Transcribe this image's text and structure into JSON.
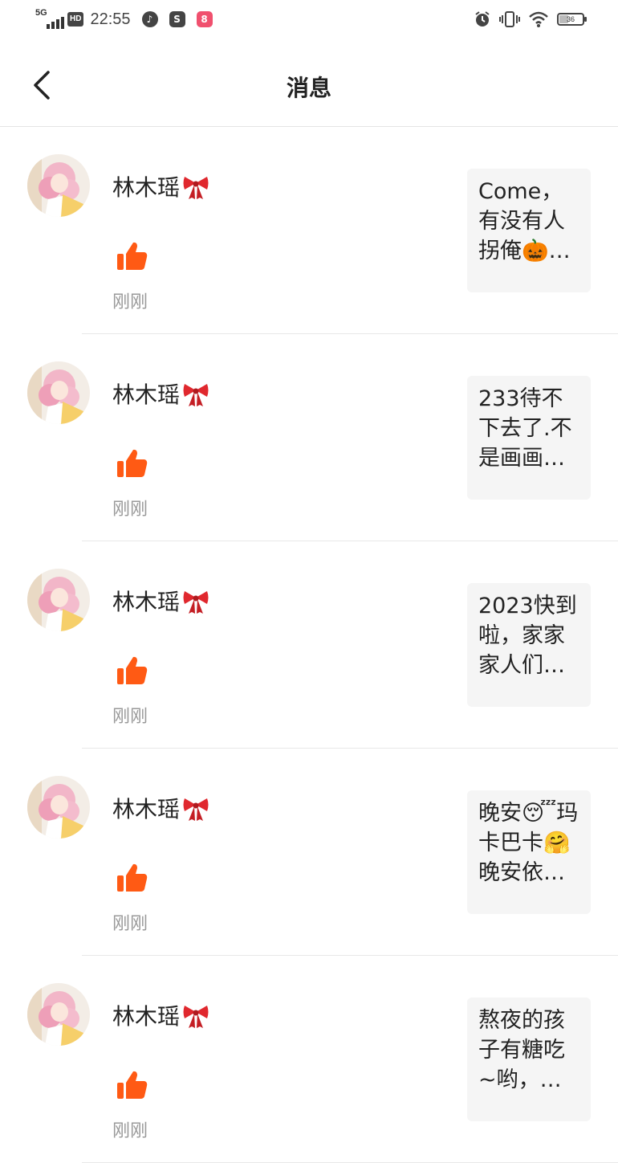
{
  "status_bar": {
    "network": "5G",
    "hd": "HD",
    "time": "22:55",
    "battery": "36"
  },
  "header": {
    "title": "消息"
  },
  "messages": [
    {
      "username": "林木瑶",
      "time": "刚刚",
      "preview": "Come，有没有人拐俺🎃…"
    },
    {
      "username": "林木瑶",
      "time": "刚刚",
      "preview": "233待不下去了.不是画画…"
    },
    {
      "username": "林木瑶",
      "time": "刚刚",
      "preview": "2023快到啦，家家家人们…"
    },
    {
      "username": "林木瑶",
      "time": "刚刚",
      "preview": "晚安😴玛卡巴卡🤗晚安依…"
    },
    {
      "username": "林木瑶",
      "time": "刚刚",
      "preview": "熬夜的孩子有糖吃~哟，…"
    }
  ],
  "colors": {
    "like": "#ff5a14",
    "bow": "#e0282e",
    "preview_bg": "#f5f5f5",
    "time": "#999999"
  }
}
